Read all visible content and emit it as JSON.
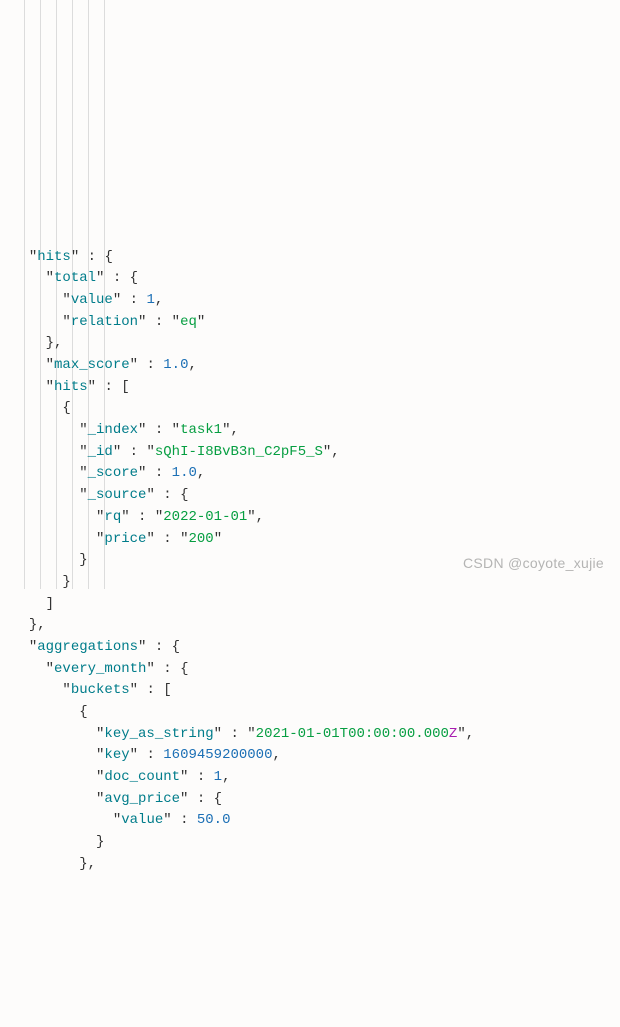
{
  "watermark": "CSDN @coyote_xujie",
  "json": {
    "hits_key": "hits",
    "total_key": "total",
    "value_key": "value",
    "relation_key": "relation",
    "max_score_key": "max_score",
    "index_key": "_index",
    "id_key": "_id",
    "score_key": "_score",
    "source_key": "_source",
    "rq_key": "rq",
    "price_key": "price",
    "aggregations_key": "aggregations",
    "every_month_key": "every_month",
    "buckets_key": "buckets",
    "key_as_string_key": "key_as_string",
    "key_key": "key",
    "doc_count_key": "doc_count",
    "avg_price_key": "avg_price",
    "total_value": "1",
    "relation_value": "eq",
    "max_score_value": "1.0",
    "index_value": "task1",
    "id_value": "sQhI-I8BvB3n_C2pF5_S",
    "score_value": "1.0",
    "rq_value": "2022-01-01",
    "price_value": "200",
    "key_as_string_value_prefix": "2021-01-01T00:00:00.000",
    "key_as_string_value_z": "Z",
    "key_value": "1609459200000",
    "doc_count_value": "1",
    "avg_price_value": "50.0"
  }
}
